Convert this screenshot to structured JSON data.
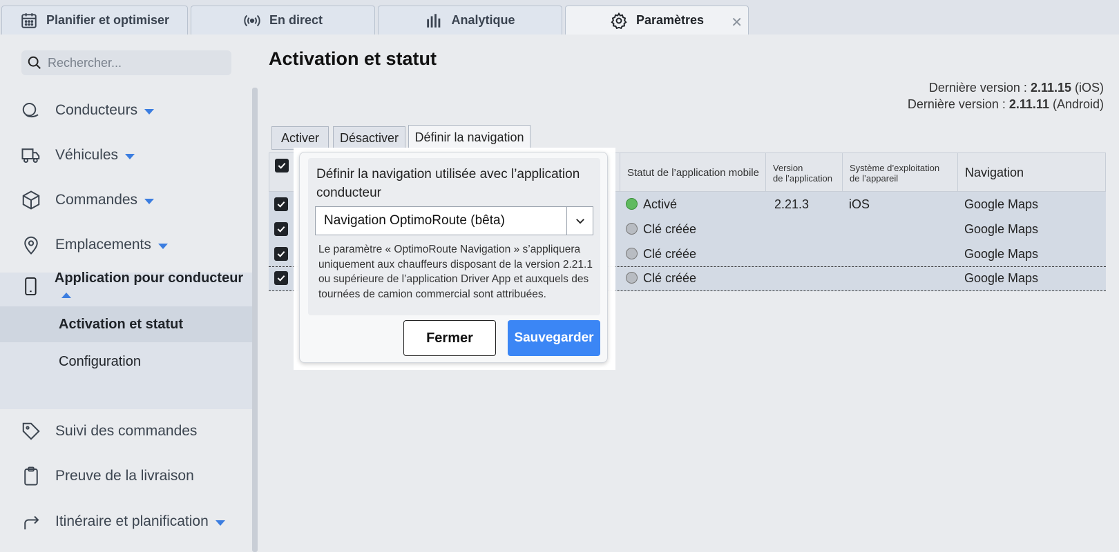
{
  "tabs": [
    {
      "label": "Planifier et optimiser",
      "icon": "calendar-icon"
    },
    {
      "label": "En direct",
      "icon": "broadcast-icon"
    },
    {
      "label": "Analytique",
      "icon": "bar-chart-icon"
    },
    {
      "label": "Paramètres",
      "icon": "gear-icon",
      "close": "✕"
    }
  ],
  "search": {
    "placeholder": "Rechercher..."
  },
  "sidebar": {
    "items": [
      {
        "label": "Conducteurs",
        "icon": "drivers-icon"
      },
      {
        "label": "Véhicules",
        "icon": "truck-icon"
      },
      {
        "label": "Commandes",
        "icon": "box-icon"
      },
      {
        "label": "Emplacements",
        "icon": "location-pin-icon"
      },
      {
        "label": "Application pour conducteur",
        "icon": "phone-icon"
      },
      {
        "label": "Suivi des commandes",
        "icon": "tag-icon"
      },
      {
        "label": "Preuve de la livraison",
        "icon": "clipboard-icon"
      },
      {
        "label": "Itinéraire et planification",
        "icon": "route-arrow-icon"
      }
    ],
    "subitems": [
      {
        "label": "Activation et statut"
      },
      {
        "label": "Configuration"
      }
    ]
  },
  "main": {
    "title": "Activation et statut",
    "version_ios": {
      "prefix": "Dernière version : ",
      "num": "2.11.15",
      "suffix": " (iOS)"
    },
    "version_android": {
      "prefix": "Dernière version : ",
      "num": "2.11.11",
      "suffix": " (Android)"
    },
    "actions": {
      "activate": "Activer",
      "deactivate": "Désactiver",
      "set_nav": "Définir la navigation"
    }
  },
  "table": {
    "headers": {
      "status": "Statut de l’application mobile",
      "version_l1": "Version",
      "version_l2": "de l’application",
      "os_l1": "Système d’exploitation",
      "os_l2": "de l’appareil",
      "navigation": "Navigation"
    },
    "rows": [
      {
        "status": "Activé",
        "status_color": "#5fba5f",
        "version": "2.21.3",
        "os": "iOS",
        "navigation": "Google Maps"
      },
      {
        "status": "Clé créée",
        "status_color": "#b8bcc2",
        "version": "",
        "os": "",
        "navigation": "Google Maps"
      },
      {
        "status": "Clé créée",
        "status_color": "#b8bcc2",
        "version": "",
        "os": "",
        "navigation": "Google Maps"
      },
      {
        "status": "Clé créée",
        "status_color": "#b8bcc2",
        "version": "",
        "os": "",
        "navigation": "Google Maps"
      }
    ]
  },
  "popup": {
    "label": "Définir la navigation utilisée avec l’application conducteur",
    "selected": "Navigation OptimoRoute (bêta)",
    "help": "Le paramètre « OptimoRoute Navigation » s’appliquera uniquement aux chauffeurs disposant de la version 2.21.1 ou supérieure de l’application Driver App et auxquels des tournées de camion commercial sont attribuées.",
    "close_label": "Fermer",
    "save_label": "Sauvegarder"
  },
  "colors": {
    "accent": "#3b86f5",
    "caret": "#3b7de0",
    "active_dot": "#5fba5f",
    "inactive_dot": "#b8bcc2"
  }
}
